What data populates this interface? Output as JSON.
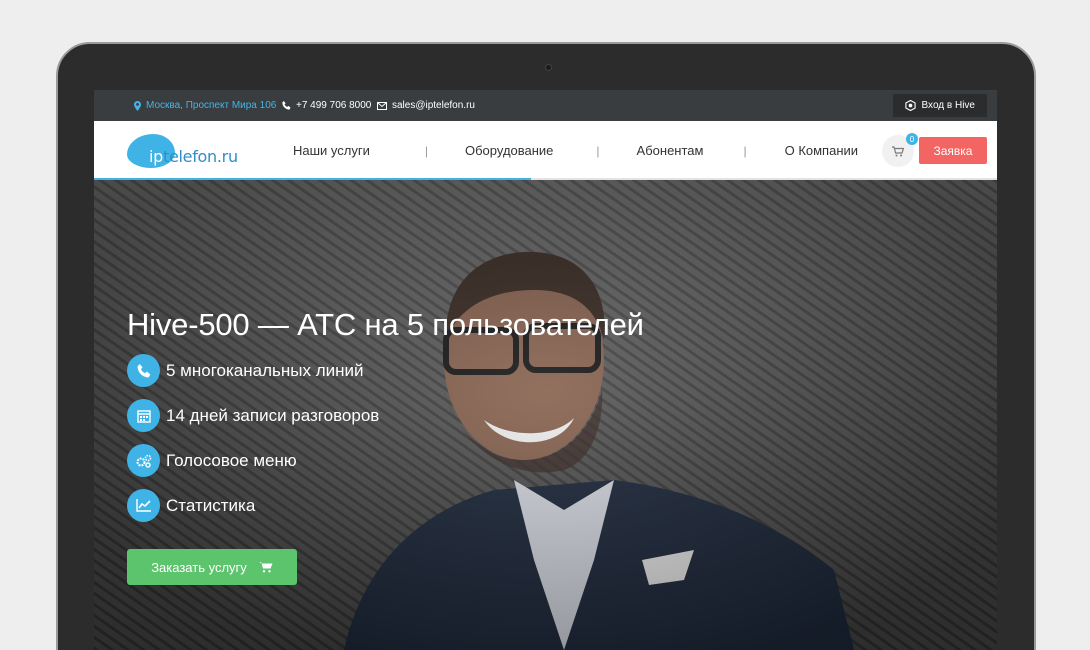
{
  "topbar": {
    "address": "Москва, Проспект Мира 106",
    "phone": "+7 499 706 8000",
    "email": "sales@iptelefon.ru",
    "login": "Вход в Hive"
  },
  "logo": {
    "ip": "ip",
    "text": "telefon.ru"
  },
  "nav": {
    "items": [
      "Наши услуги",
      "Оборудование",
      "Абонентам",
      "О Компании"
    ],
    "separator": "|",
    "cart_count": "0",
    "request_button": "Заявка"
  },
  "hero": {
    "title": "Hive-500 — АТС на 5 пользователей",
    "features": [
      {
        "icon": "phone-icon",
        "text": "5 многоканальных линий"
      },
      {
        "icon": "calendar-icon",
        "text": "14 дней записи разговоров"
      },
      {
        "icon": "gears-icon",
        "text": "Голосовое меню"
      },
      {
        "icon": "chart-icon",
        "text": "Статистика"
      }
    ],
    "order_button": "Заказать услугу"
  },
  "colors": {
    "accent": "#3fb3e6",
    "request": "#f26563",
    "order": "#5dc46e",
    "topbar": "#3a3d3f"
  }
}
